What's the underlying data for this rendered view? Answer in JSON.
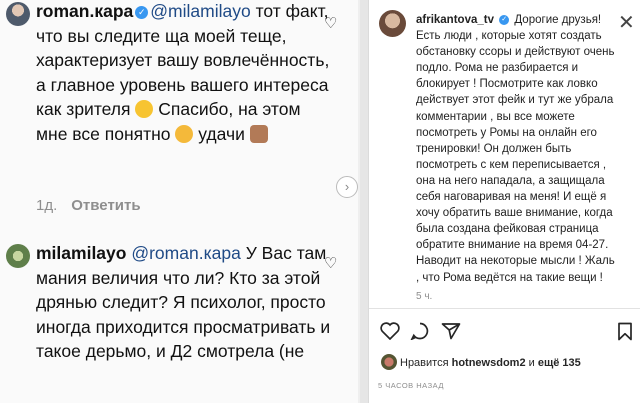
{
  "comment1": {
    "username": "roman.кара",
    "mention": "@milamilayo",
    "text": "тот факт, что вы следите ща моей теще, характеризует вашу вовлечённость, а главное уровень вашего интереса как зрителя",
    "text2": "Спасибо, на этом мне все понятно",
    "text3": "удачи",
    "time": "1д.",
    "reply_label": "Ответить"
  },
  "comment2": {
    "username": "milamilayo",
    "mention": "@roman.кара",
    "text": "У Вас там мания величия что ли? Кто за этой дрянью следит? Я психолог, просто иногда приходится просматривать и такое дерьмо, и Д2 смотрела (не"
  },
  "post": {
    "username": "afrikantova_tv",
    "text": "Дорогие друзья! Есть люди , которые хотят создать обстановку ссоры и действуют очень подло. Рома не разбирается и блокирует ! Посмотрите как ловко действует этот фейк и тут же убрала комментарии , вы все можете посмотреть у Ромы на онлайн его тренировки! Он должен быть посмотреть с кем переписывается , она на него нападала, а защищала себя наговаривая на меня! И ещё я хочу обратить ваше внимание, когда была создана фейковая страница обратите внимание на время 04-27. Наводит на некоторые мысли ! Жаль , что Рома ведётся на такие вещи !",
    "time": "5 ч.",
    "likes_prefix": "Нравится",
    "likes_user": "hotnewsdom2",
    "likes_and": "и",
    "likes_more": "ещё 135",
    "ago": "5 ЧАСОВ НАЗАД"
  },
  "icons": {
    "verified": "verified-badge",
    "heart": "heart-icon",
    "comment": "comment-icon",
    "share": "share-icon",
    "bookmark": "bookmark-icon",
    "close": "close-icon",
    "next": "chevron-right-icon"
  },
  "colors": {
    "verified": "#3897f0",
    "mention": "#1f4a86",
    "muted": "#8e8e8e"
  }
}
